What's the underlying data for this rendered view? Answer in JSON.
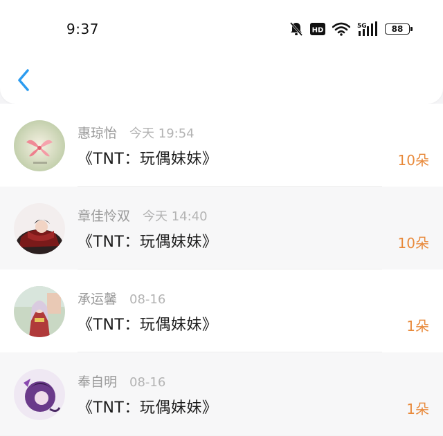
{
  "status_bar": {
    "time": "9:37",
    "network": "5G",
    "hd_badge": "HD",
    "battery": "88"
  },
  "nav": {
    "back_icon": "chevron-left-icon",
    "accent_color": "#2c9cf0"
  },
  "gifts": [
    {
      "name": "惠琼怡",
      "time": "今天 19:54",
      "title": "《TNT：玩偶妹妹》",
      "amount": "10朵"
    },
    {
      "name": "章佳怜双",
      "time": "今天 14:40",
      "title": "《TNT：玩偶妹妹》",
      "amount": "10朵"
    },
    {
      "name": "承运馨",
      "time": "08-16",
      "title": "《TNT：玩偶妹妹》",
      "amount": "1朵"
    },
    {
      "name": "奉自明",
      "time": "08-16",
      "title": "《TNT：玩偶妹妹》",
      "amount": "1朵"
    }
  ],
  "colors": {
    "amount": "#e8893a",
    "name": "#9a9a9a",
    "title": "#1a1a1a"
  }
}
